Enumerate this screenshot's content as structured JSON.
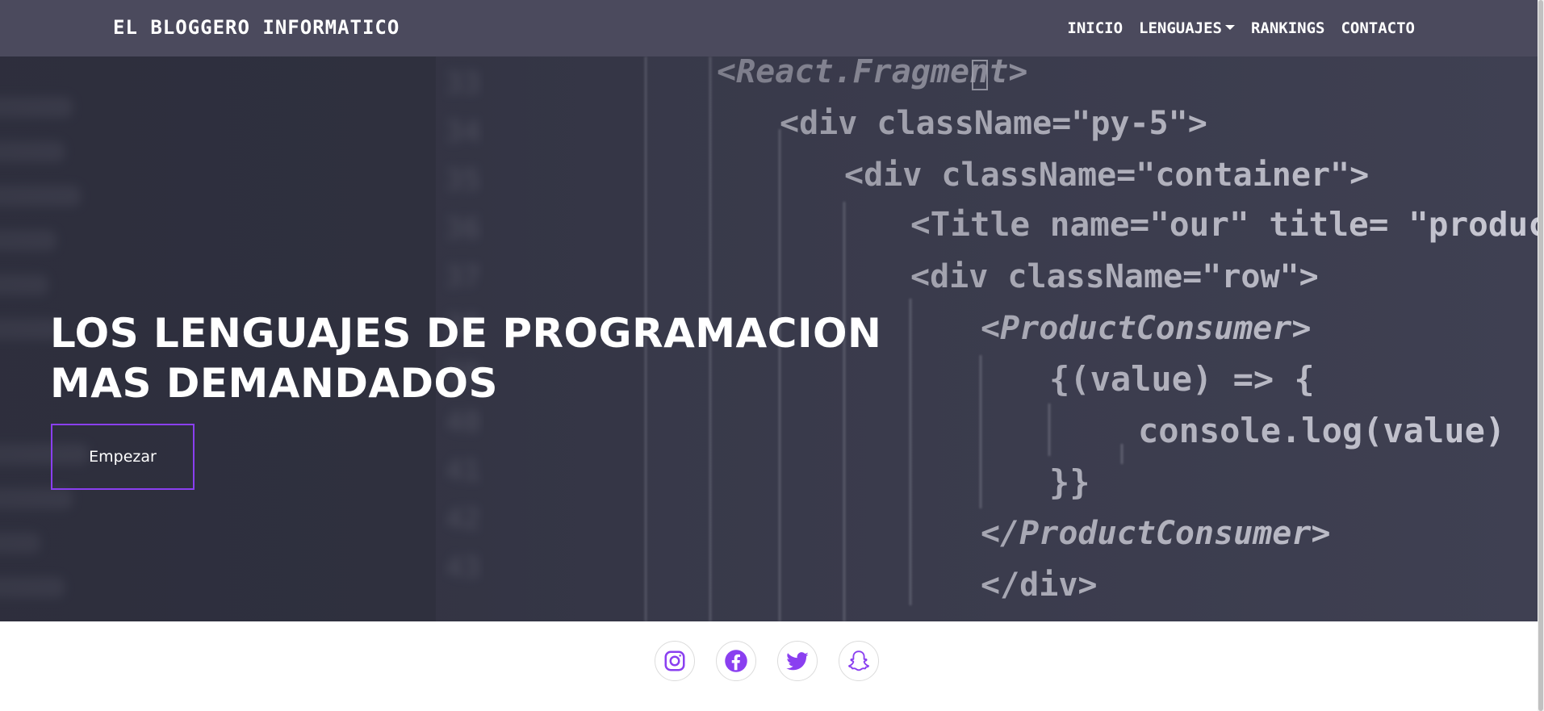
{
  "navbar": {
    "brand": "EL BLOGGERO INFORMATICO",
    "items": [
      {
        "label": "INICIO"
      },
      {
        "label": "LENGUAJES",
        "dropdown": true
      },
      {
        "label": "RANKINGS"
      },
      {
        "label": "CONTACTO"
      }
    ],
    "background": "#4b4a5d"
  },
  "hero": {
    "title_line1": "LOS LENGUAJES DE PROGRAMACION",
    "title_line2": "MAS DEMANDADOS",
    "button_label": "Empezar",
    "accent": "#8a3ff0",
    "code_lines": [
      "<React.Fragment>",
      "<div className=\"py-5\">",
      "<div className=\"container\">",
      "<Title name=\"our\" title= \"product",
      "<div className=\"row\">",
      "<ProductConsumer>",
      "{(value) => {",
      "console.log(value)",
      "}}",
      "</ProductConsumer>",
      "</div>"
    ]
  },
  "footer": {
    "icon_color": "#8a3ff0",
    "socials": [
      {
        "icon": "instagram-icon"
      },
      {
        "icon": "facebook-icon"
      },
      {
        "icon": "twitter-icon"
      },
      {
        "icon": "snapchat-icon"
      }
    ]
  }
}
